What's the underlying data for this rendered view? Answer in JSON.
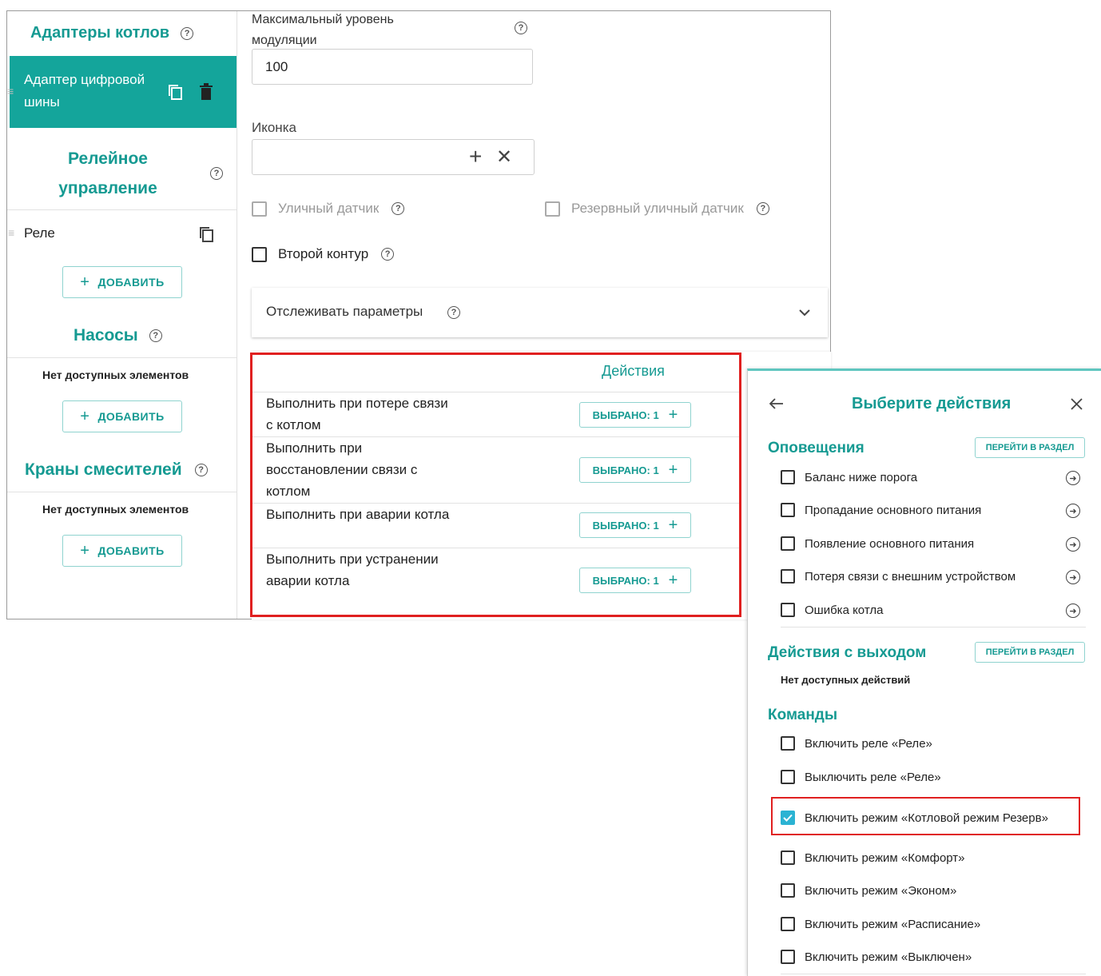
{
  "sidebar": {
    "adapters_title": "Адаптеры котлов",
    "adapter_item": "Адаптер цифровой шины",
    "relay_title": "Релейное управление",
    "relay_item": "Реле",
    "add_label": "ДОБАВИТЬ",
    "pumps_title": "Насосы",
    "no_items": "Нет доступных элементов",
    "mixers_title": "Краны смесителей"
  },
  "form": {
    "modulation_label": "Максимальный уровень модуляции",
    "modulation_value": "100",
    "icon_label": "Иконка",
    "street_sensor": "Уличный датчик",
    "reserve_street_sensor": "Резервный уличный датчик",
    "second_circuit": "Второй контур",
    "track_params": "Отслеживать параметры"
  },
  "actions_table": {
    "header": "Действия",
    "rows": [
      {
        "label": "Выполнить при потере связи с котлом",
        "button": "ВЫБРАНО: 1"
      },
      {
        "label": "Выполнить при восстановлении связи с котлом",
        "button": "ВЫБРАНО: 1"
      },
      {
        "label": "Выполнить при аварии котла",
        "button": "ВЫБРАНО: 1"
      },
      {
        "label": "Выполнить при устранении аварии котла",
        "button": "ВЫБРАНО: 1"
      }
    ]
  },
  "panel": {
    "title": "Выберите действия",
    "notifications_title": "Оповещения",
    "goto_label": "ПЕРЕЙТИ В РАЗДЕЛ",
    "notifications": [
      "Баланс ниже порога",
      "Пропадание основного питания",
      "Появление основного питания",
      "Потеря связи с внешним устройством",
      "Ошибка котла"
    ],
    "output_title": "Действия с выходом",
    "no_actions": "Нет доступных действий",
    "commands_title": "Команды",
    "commands": [
      {
        "label": "Включить реле «Реле»",
        "checked": false
      },
      {
        "label": "Выключить реле «Реле»",
        "checked": false
      },
      {
        "label": "Включить режим «Котловой режим Резерв»",
        "checked": true
      },
      {
        "label": "Включить режим «Комфорт»",
        "checked": false
      },
      {
        "label": "Включить режим «Эконом»",
        "checked": false
      },
      {
        "label": "Включить режим «Расписание»",
        "checked": false
      },
      {
        "label": "Включить режим «Выключен»",
        "checked": false
      }
    ]
  },
  "colors": {
    "accent": "#159a92",
    "highlight": "#e02020",
    "checkbox_checked": "#2bb3d3"
  }
}
